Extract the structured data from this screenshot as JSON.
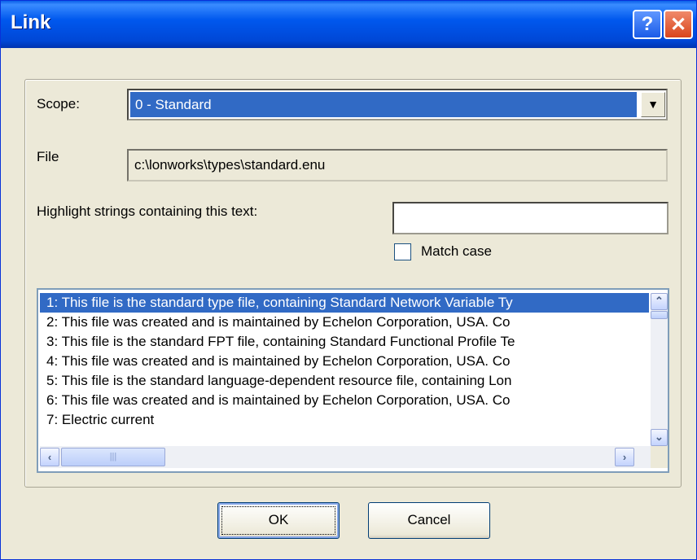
{
  "window": {
    "title": "Link",
    "help_glyph": "?",
    "close_glyph": "✕"
  },
  "scope": {
    "label": "Scope:",
    "value": "0 - Standard",
    "arrow": "▼"
  },
  "file": {
    "label": "File",
    "value": "c:\\lonworks\\types\\standard.enu"
  },
  "highlight": {
    "label": "Highlight strings containing this text:",
    "value": ""
  },
  "match_case": {
    "label": "Match case",
    "checked": false
  },
  "list": {
    "items": [
      "1:  This file is the standard type file, containing Standard Network Variable Ty",
      "2:  This file was created and is maintained by Echelon Corporation, USA.  Co",
      "3:  This file is the standard FPT file, containing Standard Functional Profile Te",
      "4:  This file was created and is maintained by Echelon Corporation, USA.  Co",
      "5:  This file is the standard language-dependent resource file, containing Lon",
      "6:  This file was created and is maintained by Echelon Corporation, USA.  Co",
      "7:  Electric current"
    ],
    "selected_index": 0
  },
  "buttons": {
    "ok": "OK",
    "cancel": "Cancel"
  },
  "colors": {
    "selection": "#316ac5",
    "titlebar": "#0058ee",
    "dialog_bg": "#ece9d8"
  }
}
